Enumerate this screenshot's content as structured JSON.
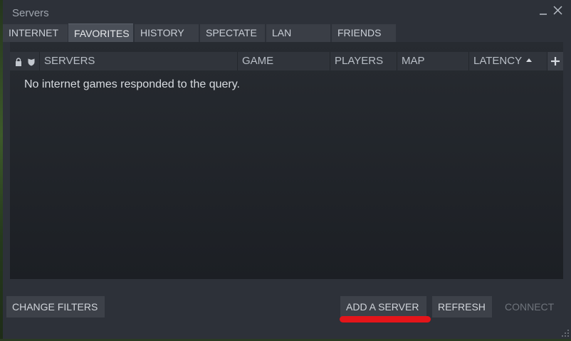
{
  "window": {
    "title": "Servers",
    "accent_color": "#e4151a",
    "minimize_icon": "minimize-icon",
    "close_icon": "close-icon"
  },
  "tabs": [
    {
      "label": "INTERNET",
      "active": false
    },
    {
      "label": "FAVORITES",
      "active": true
    },
    {
      "label": "HISTORY",
      "active": false
    },
    {
      "label": "SPECTATE",
      "active": false
    },
    {
      "label": "LAN",
      "active": false
    },
    {
      "label": "FRIENDS",
      "active": false
    }
  ],
  "table": {
    "lock_icon": "lock-icon",
    "shield_icon": "shield-icon",
    "columns": [
      "SERVERS",
      "GAME",
      "PLAYERS",
      "MAP",
      "LATENCY"
    ],
    "sorted_column": "LATENCY",
    "sort_direction": "ascending",
    "add_column_icon": "plus-icon",
    "empty_message": "No internet games responded to the query."
  },
  "buttons": {
    "change_filters": "CHANGE FILTERS",
    "add_server": "ADD A SERVER",
    "refresh": "REFRESH",
    "connect": "CONNECT"
  }
}
